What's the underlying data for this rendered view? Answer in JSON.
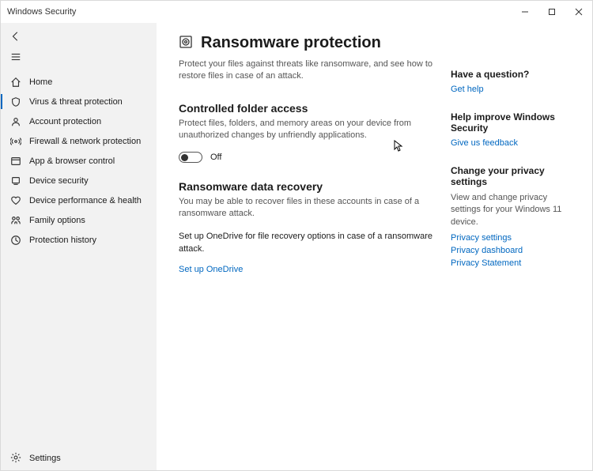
{
  "window": {
    "title": "Windows Security"
  },
  "sidebar": {
    "items": [
      {
        "label": "Home",
        "icon": "home"
      },
      {
        "label": "Virus & threat protection",
        "icon": "shield",
        "active": true
      },
      {
        "label": "Account protection",
        "icon": "account"
      },
      {
        "label": "Firewall & network protection",
        "icon": "network"
      },
      {
        "label": "App & browser control",
        "icon": "app"
      },
      {
        "label": "Device security",
        "icon": "device"
      },
      {
        "label": "Device performance & health",
        "icon": "heart"
      },
      {
        "label": "Family options",
        "icon": "family"
      },
      {
        "label": "Protection history",
        "icon": "history"
      }
    ],
    "footer": {
      "label": "Settings",
      "icon": "gear"
    }
  },
  "page": {
    "title": "Ransomware protection",
    "subtitle": "Protect your files against threats like ransomware, and see how to restore files in case of an attack.",
    "sections": {
      "cfa": {
        "heading": "Controlled folder access",
        "body": "Protect files, folders, and memory areas on your device from unauthorized changes by unfriendly applications.",
        "toggle_state": "Off"
      },
      "recovery": {
        "heading": "Ransomware data recovery",
        "body": "You may be able to recover files in these accounts in case of a ransomware attack.",
        "onedrive_note": "Set up OneDrive for file recovery options in case of a ransomware attack.",
        "onedrive_link": "Set up OneDrive"
      }
    }
  },
  "right": {
    "q": {
      "heading": "Have a question?",
      "link": "Get help"
    },
    "improve": {
      "heading": "Help improve Windows Security",
      "link": "Give us feedback"
    },
    "privacy": {
      "heading": "Change your privacy settings",
      "body": "View and change privacy settings for your Windows 11 device.",
      "links": [
        "Privacy settings",
        "Privacy dashboard",
        "Privacy Statement"
      ]
    }
  }
}
